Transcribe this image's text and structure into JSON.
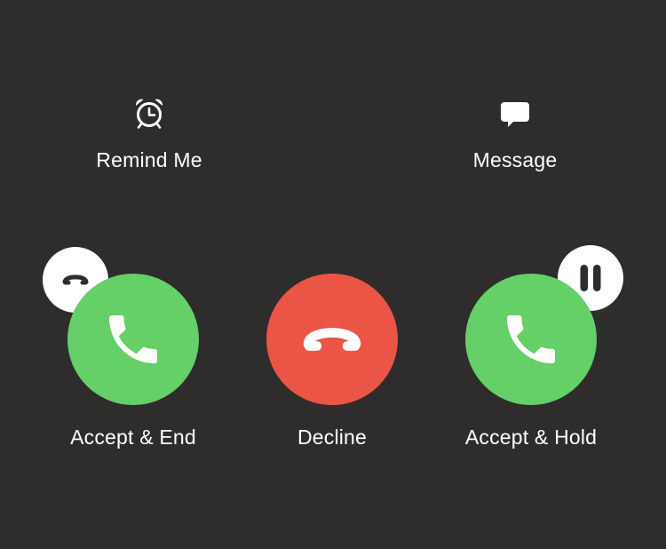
{
  "top_actions": {
    "remind": {
      "label": "Remind Me",
      "icon": "alarm-clock-icon"
    },
    "message": {
      "label": "Message",
      "icon": "message-bubble-icon"
    }
  },
  "call_buttons": {
    "accept_end": {
      "label": "Accept & End",
      "icon": "phone-icon",
      "badge_icon": "end-call-icon",
      "color": "#65cf68"
    },
    "decline": {
      "label": "Decline",
      "icon": "end-call-icon",
      "color": "#eb5545"
    },
    "accept_hold": {
      "label": "Accept & Hold",
      "icon": "phone-icon",
      "badge_icon": "pause-icon",
      "color": "#65cf68"
    }
  },
  "colors": {
    "background": "#2e2d2b",
    "text": "#ffffff",
    "badge": "#ffffff"
  }
}
